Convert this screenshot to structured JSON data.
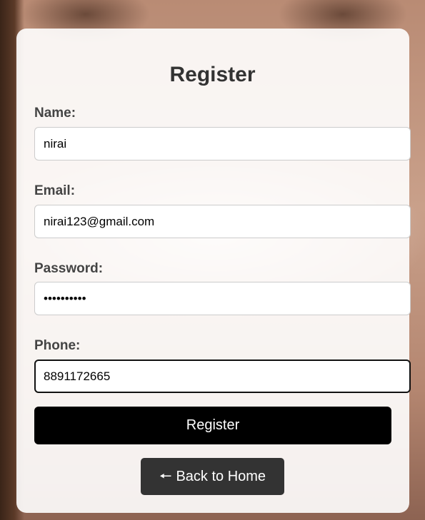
{
  "form": {
    "title": "Register",
    "name_label": "Name:",
    "name_value": "nirai",
    "email_label": "Email:",
    "email_value": "nirai123@gmail.com",
    "password_label": "Password:",
    "password_value": "••••••••••",
    "phone_label": "Phone:",
    "phone_value": "8891172665",
    "submit_label": "Register"
  },
  "nav": {
    "back_icon": "left-arrow-icon",
    "back_label": "Back to Home"
  }
}
